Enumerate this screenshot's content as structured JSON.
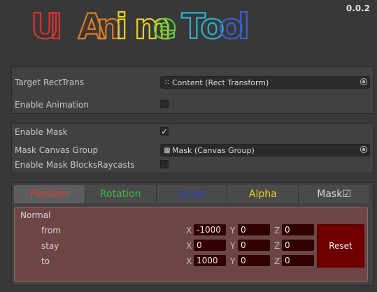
{
  "header": {
    "title": "UI Anime Tool",
    "version": "0.0.2",
    "title_colors": [
      "#e03030",
      "#e07b22",
      "#e6cf2a",
      "#5bcc3a",
      "#2fb0c8",
      "#3a5fd0",
      "#7a3ad0",
      "#c83ad0"
    ]
  },
  "section1": {
    "target_label": "Target RectTrans",
    "target_value": "Content (Rect Transform)",
    "target_icon": "rect-transform-icon",
    "enable_animation_label": "Enable Animation",
    "enable_animation_checked": false
  },
  "section2": {
    "enable_mask_label": "Enable Mask",
    "enable_mask_checked": true,
    "mask_group_label": "Mask Canvas Group",
    "mask_group_value": "Mask (Canvas Group)",
    "mask_group_icon": "canvas-group-icon",
    "blocks_raycasts_label": "Enable Mask BlocksRaycasts",
    "blocks_raycasts_checked": false
  },
  "tabs": [
    {
      "label": "Position",
      "color": "#e03a3a",
      "active": true
    },
    {
      "label": "Rotation",
      "color": "#3fb83f",
      "active": false
    },
    {
      "label": "Scale",
      "color": "#2f45c8",
      "active": false
    },
    {
      "label": "Alpha",
      "color": "#e6d02a",
      "active": false
    },
    {
      "label": "Mask☑",
      "color": "#d8d8d8",
      "active": false
    }
  ],
  "normal": {
    "title": "Normal",
    "rows": [
      {
        "label": "from",
        "x": "-1000",
        "y": "0",
        "z": "0"
      },
      {
        "label": "stay",
        "x": "0",
        "y": "0",
        "z": "0"
      },
      {
        "label": "to",
        "x": "1000",
        "y": "0",
        "z": "0"
      }
    ],
    "axis_labels": [
      "X",
      "Y",
      "Z"
    ],
    "reset_label": "Reset"
  }
}
